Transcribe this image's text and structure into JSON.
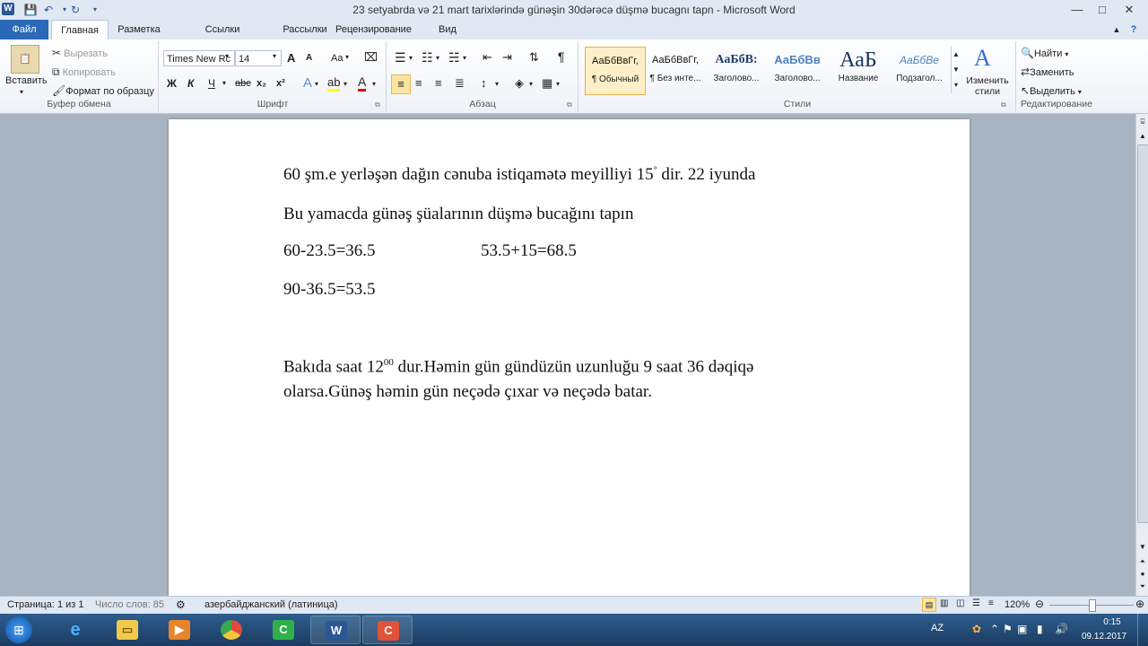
{
  "window": {
    "title": "23  setyabrda və 21 mart tarixlərində  günəşin  30dərəcə düşmə bucagnı tapn  -  Microsoft Word",
    "app_icon": "W",
    "controls": {
      "minimize": "—",
      "maximize": "□",
      "close": "✕"
    }
  },
  "tabs": [
    "Файл",
    "Главная",
    "Разметка страницы",
    "Ссылки",
    "Рассылки",
    "Рецензирование",
    "Вид"
  ],
  "ribbon": {
    "clipboard": {
      "label": "Буфер обмена",
      "paste": "Вставить",
      "cut": "Вырезать",
      "copy": "Копировать",
      "format_painter": "Формат по образцу"
    },
    "font": {
      "label": "Шрифт",
      "name": "Times New Rc",
      "size": "14",
      "bold": "Ж",
      "italic": "К",
      "underline": "Ч",
      "strike": "abc",
      "subscript": "x₂",
      "superscript": "x²",
      "change_case": "Aa",
      "grow": "A",
      "shrink": "A"
    },
    "paragraph": {
      "label": "Абзац",
      "pilcrow": "¶"
    },
    "styles": {
      "label": "Стили",
      "items": [
        {
          "sample": "АаБбВвГг,",
          "name": "¶ Обычный"
        },
        {
          "sample": "АаБбВвГг,",
          "name": "¶ Без инте..."
        },
        {
          "sample": "АаБбВ:",
          "name": "Заголово..."
        },
        {
          "sample": "АаБбВв",
          "name": "Заголово..."
        },
        {
          "sample": "АаБ",
          "name": "Название"
        },
        {
          "sample": "АаБбВе",
          "name": "Подзагол..."
        }
      ],
      "change_styles": "Изменить стили"
    },
    "editing": {
      "label": "Редактирование",
      "find": "Найти",
      "replace": "Заменить",
      "select": "Выделить"
    }
  },
  "document": {
    "l1": "60 şm.e   yerləşən dağın cənuba  istiqamətə meyilliyi 15",
    "l1_sup": "°",
    "l1_end": "  dir. 22 iyunda",
    "l2": "Bu yamacda günəş şüalarının düşmə  bucağını tapın",
    "l3a": "60-23.5=36.5",
    "l3b": "53.5+15=68.5",
    "l4": "90-36.5=53.5",
    "l5a": "Bakıda saat  12",
    "l5_sup": "00",
    "l5b": "  dur.Həmin gün  gündüzün  uzunluğu 9 saat 36 dəqiqə",
    "l6": "olarsa.Günəş həmin gün  neçədə çıxar və  neçədə batar."
  },
  "status": {
    "page": "Страница: 1 из 1",
    "words": "Число слов: 85",
    "language": "азербайджанский (латиница)",
    "zoom": "120%"
  },
  "taskbar": {
    "lang": "AZ",
    "time": "0:15",
    "date": "09.12.2017"
  }
}
